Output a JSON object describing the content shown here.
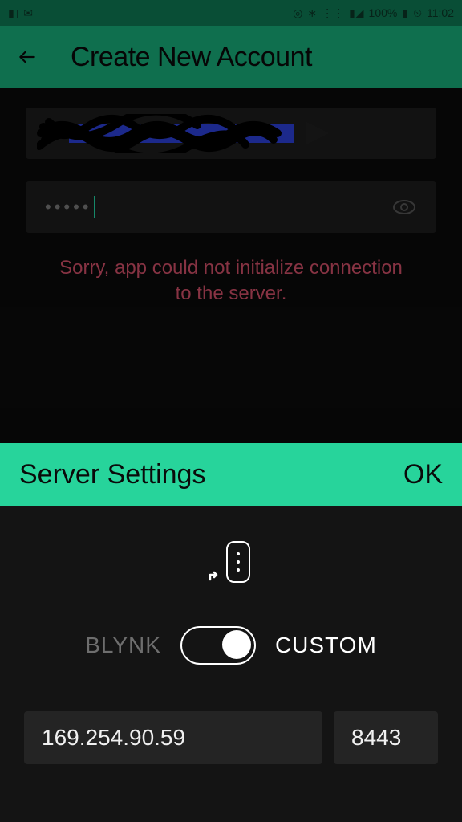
{
  "status": {
    "left_icons": [
      "notification-icon",
      "mail-icon"
    ],
    "right_icons": [
      "location-icon",
      "bluetooth-icon",
      "wifi-icon",
      "signal-icon"
    ],
    "battery": "100%",
    "time": "11:02"
  },
  "header": {
    "title": "Create New Account"
  },
  "form": {
    "email_value": "",
    "password_value": "•••••",
    "error": "Sorry, app could not initialize connection to the server."
  },
  "server": {
    "title": "Server Settings",
    "ok": "OK",
    "option_left": "BLYNK",
    "option_right": "CUSTOM",
    "selected": "CUSTOM",
    "ip": "169.254.90.59",
    "port": "8443"
  }
}
